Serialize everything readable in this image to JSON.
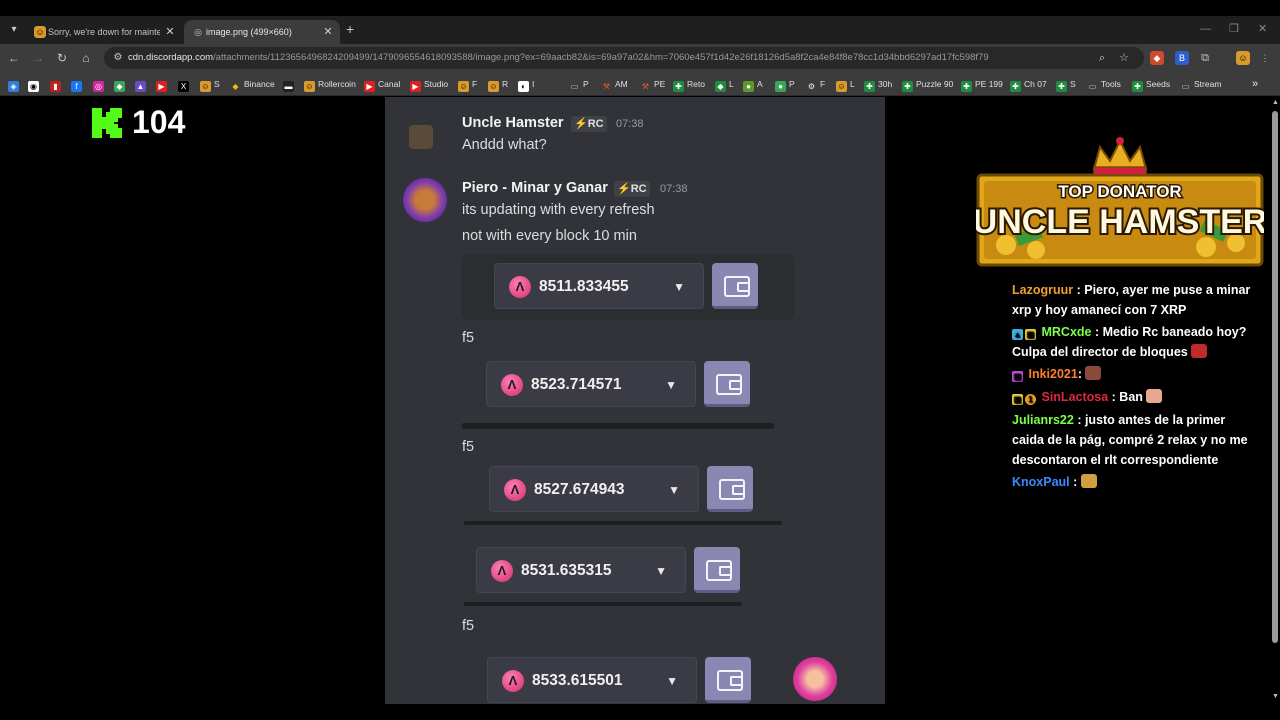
{
  "browser": {
    "tabs": [
      {
        "title": "Sorry, we're down for maintenance"
      },
      {
        "title": "image.png (499×660)"
      }
    ],
    "url_host": "cdn.discordapp.com",
    "url_path": "/attachments/1123656496824209499/1479096554618093588/image.png?ex=69aacb82&is=69a97a02&hm=7060e457f1d42e26f18126d5a8f2ca4e84f8e78cc1d34bbd6297ad17fc598f79",
    "bookmarks": [
      "S",
      "Binance",
      "Rollercoin",
      "Canal",
      "Studio",
      "F",
      "R",
      "I",
      "P",
      "AM",
      "PE",
      "Reto",
      "L",
      "A",
      "P",
      "F",
      "L",
      "30h",
      "Puzzle 90",
      "PE 199",
      "Ch 07",
      "S",
      "Tools",
      "Seeds",
      "Stream"
    ]
  },
  "stream": {
    "kick_viewers": "104",
    "banner_top": "TOP DONATOR",
    "banner_name": "UNCLE HAMSTER"
  },
  "discord": {
    "messages": [
      {
        "user": "Uncle Hamster",
        "badge": "RC",
        "time": "07:38",
        "lines": [
          "Anddd what?"
        ]
      },
      {
        "user": "Piero - Minar y Ganar",
        "badge": "RC",
        "time": "07:38",
        "lines": [
          "its updating with every refresh",
          "not with every block 10 min"
        ]
      }
    ],
    "balances": [
      "8511.833455",
      "8523.714571",
      "8527.674943",
      "8531.635315",
      "8533.615501"
    ],
    "f5_label": "f5"
  },
  "chat": [
    {
      "nick": "Lazogruur",
      "text": ": Piero, ayer me puse a minar xrp y hoy amanecí con 7 XRP",
      "color": "#f0a030"
    },
    {
      "nick": "MRCxde",
      "text": ": Medio Rc baneado hoy? Culpa del director de bloques",
      "color": "#7dff4a"
    },
    {
      "nick": "Inki2021",
      "text": ":",
      "color": "#ff7f2a"
    },
    {
      "nick": "SinLactosa",
      "text": ": Ban",
      "color": "#e0283c"
    },
    {
      "nick": "Julianrs22",
      "text": ": justo antes de la primer caida de la pág, compré 2 relax y no me descontaron el rlt correspondiente",
      "color": "#7dff4a"
    },
    {
      "nick": "KnoxPaul",
      "text": ":",
      "color": "#3a8bff"
    }
  ],
  "colors": {
    "discord_bg": "#313338",
    "balance_pink": "#e0467f",
    "wallet": "#8a88b2",
    "kick_green": "#53fc18"
  }
}
